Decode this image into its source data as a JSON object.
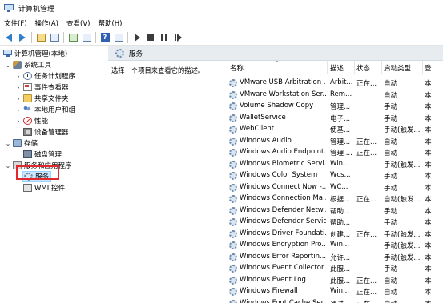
{
  "window": {
    "title": "计算机管理"
  },
  "menu": [
    "文件(F)",
    "操作(A)",
    "查看(V)",
    "帮助(H)"
  ],
  "toolbar_icons": [
    "back-arrow-icon",
    "forward-arrow-icon",
    "up-folder-icon",
    "show-tree-icon",
    "refresh-icon",
    "export-list-icon",
    "help-icon",
    "properties-icon",
    "start-service-icon",
    "stop-service-icon",
    "pause-service-icon",
    "restart-service-icon"
  ],
  "tree": {
    "root": "计算机管理(本地)",
    "system_tools": "系统工具",
    "task_scheduler": "任务计划程序",
    "event_viewer": "事件查看器",
    "shared_folders": "共享文件夹",
    "local_users": "本地用户和组",
    "performance": "性能",
    "device_manager": "设备管理器",
    "storage": "存储",
    "disk_management": "磁盘管理",
    "services_apps": "服务和应用程序",
    "services": "服务",
    "wmi": "WMI 控件"
  },
  "panel": {
    "header": "服务",
    "description_hint": "选择一个项目来查看它的描述。"
  },
  "columns": {
    "name": "名称",
    "description": "描述",
    "status": "状态",
    "startup": "启动类型",
    "logon": "登"
  },
  "accent": "#e0282e",
  "services": [
    {
      "name": "VMware USB Arbitration ...",
      "desc": "Arbit...",
      "status": "正在...",
      "startup": "自动",
      "logon": "本"
    },
    {
      "name": "VMware Workstation Ser...",
      "desc": "Rem...",
      "status": "",
      "startup": "自动",
      "logon": "本"
    },
    {
      "name": "Volume Shadow Copy",
      "desc": "管理...",
      "status": "",
      "startup": "手动",
      "logon": "本"
    },
    {
      "name": "WalletService",
      "desc": "电子...",
      "status": "",
      "startup": "手动",
      "logon": "本"
    },
    {
      "name": "WebClient",
      "desc": "使基...",
      "status": "",
      "startup": "手动(触发...",
      "logon": "本"
    },
    {
      "name": "Windows Audio",
      "desc": "管理...",
      "status": "正在...",
      "startup": "自动",
      "logon": "本"
    },
    {
      "name": "Windows Audio Endpoint...",
      "desc": "管理 ...",
      "status": "正在...",
      "startup": "自动",
      "logon": "本"
    },
    {
      "name": "Windows Biometric Servi...",
      "desc": "Win...",
      "status": "",
      "startup": "手动(触发...",
      "logon": "本"
    },
    {
      "name": "Windows Color System",
      "desc": "Wcs...",
      "status": "",
      "startup": "手动",
      "logon": "本"
    },
    {
      "name": "Windows Connect Now -...",
      "desc": "WC...",
      "status": "",
      "startup": "手动",
      "logon": "本"
    },
    {
      "name": "Windows Connection Ma...",
      "desc": "根据...",
      "status": "正在...",
      "startup": "自动(触发...",
      "logon": "本"
    },
    {
      "name": "Windows Defender Netw...",
      "desc": "帮助...",
      "status": "",
      "startup": "手动",
      "logon": "本"
    },
    {
      "name": "Windows Defender Service",
      "desc": "帮助...",
      "status": "",
      "startup": "手动",
      "logon": "本"
    },
    {
      "name": "Windows Driver Foundati...",
      "desc": "创建...",
      "status": "正在...",
      "startup": "手动(触发...",
      "logon": "本"
    },
    {
      "name": "Windows Encryption Pro...",
      "desc": "Win...",
      "status": "",
      "startup": "手动(触发...",
      "logon": "本"
    },
    {
      "name": "Windows Error Reportin...",
      "desc": "允许...",
      "status": "",
      "startup": "手动(触发...",
      "logon": "本"
    },
    {
      "name": "Windows Event Collector",
      "desc": "此服...",
      "status": "",
      "startup": "手动",
      "logon": "本"
    },
    {
      "name": "Windows Event Log",
      "desc": "此服...",
      "status": "正在...",
      "startup": "自动",
      "logon": "本"
    },
    {
      "name": "Windows Firewall",
      "desc": "Win...",
      "status": "正在...",
      "startup": "自动",
      "logon": "本"
    },
    {
      "name": "Windows Font Cache Ser...",
      "desc": "通过...",
      "status": "正在...",
      "startup": "自动",
      "logon": "本"
    }
  ]
}
